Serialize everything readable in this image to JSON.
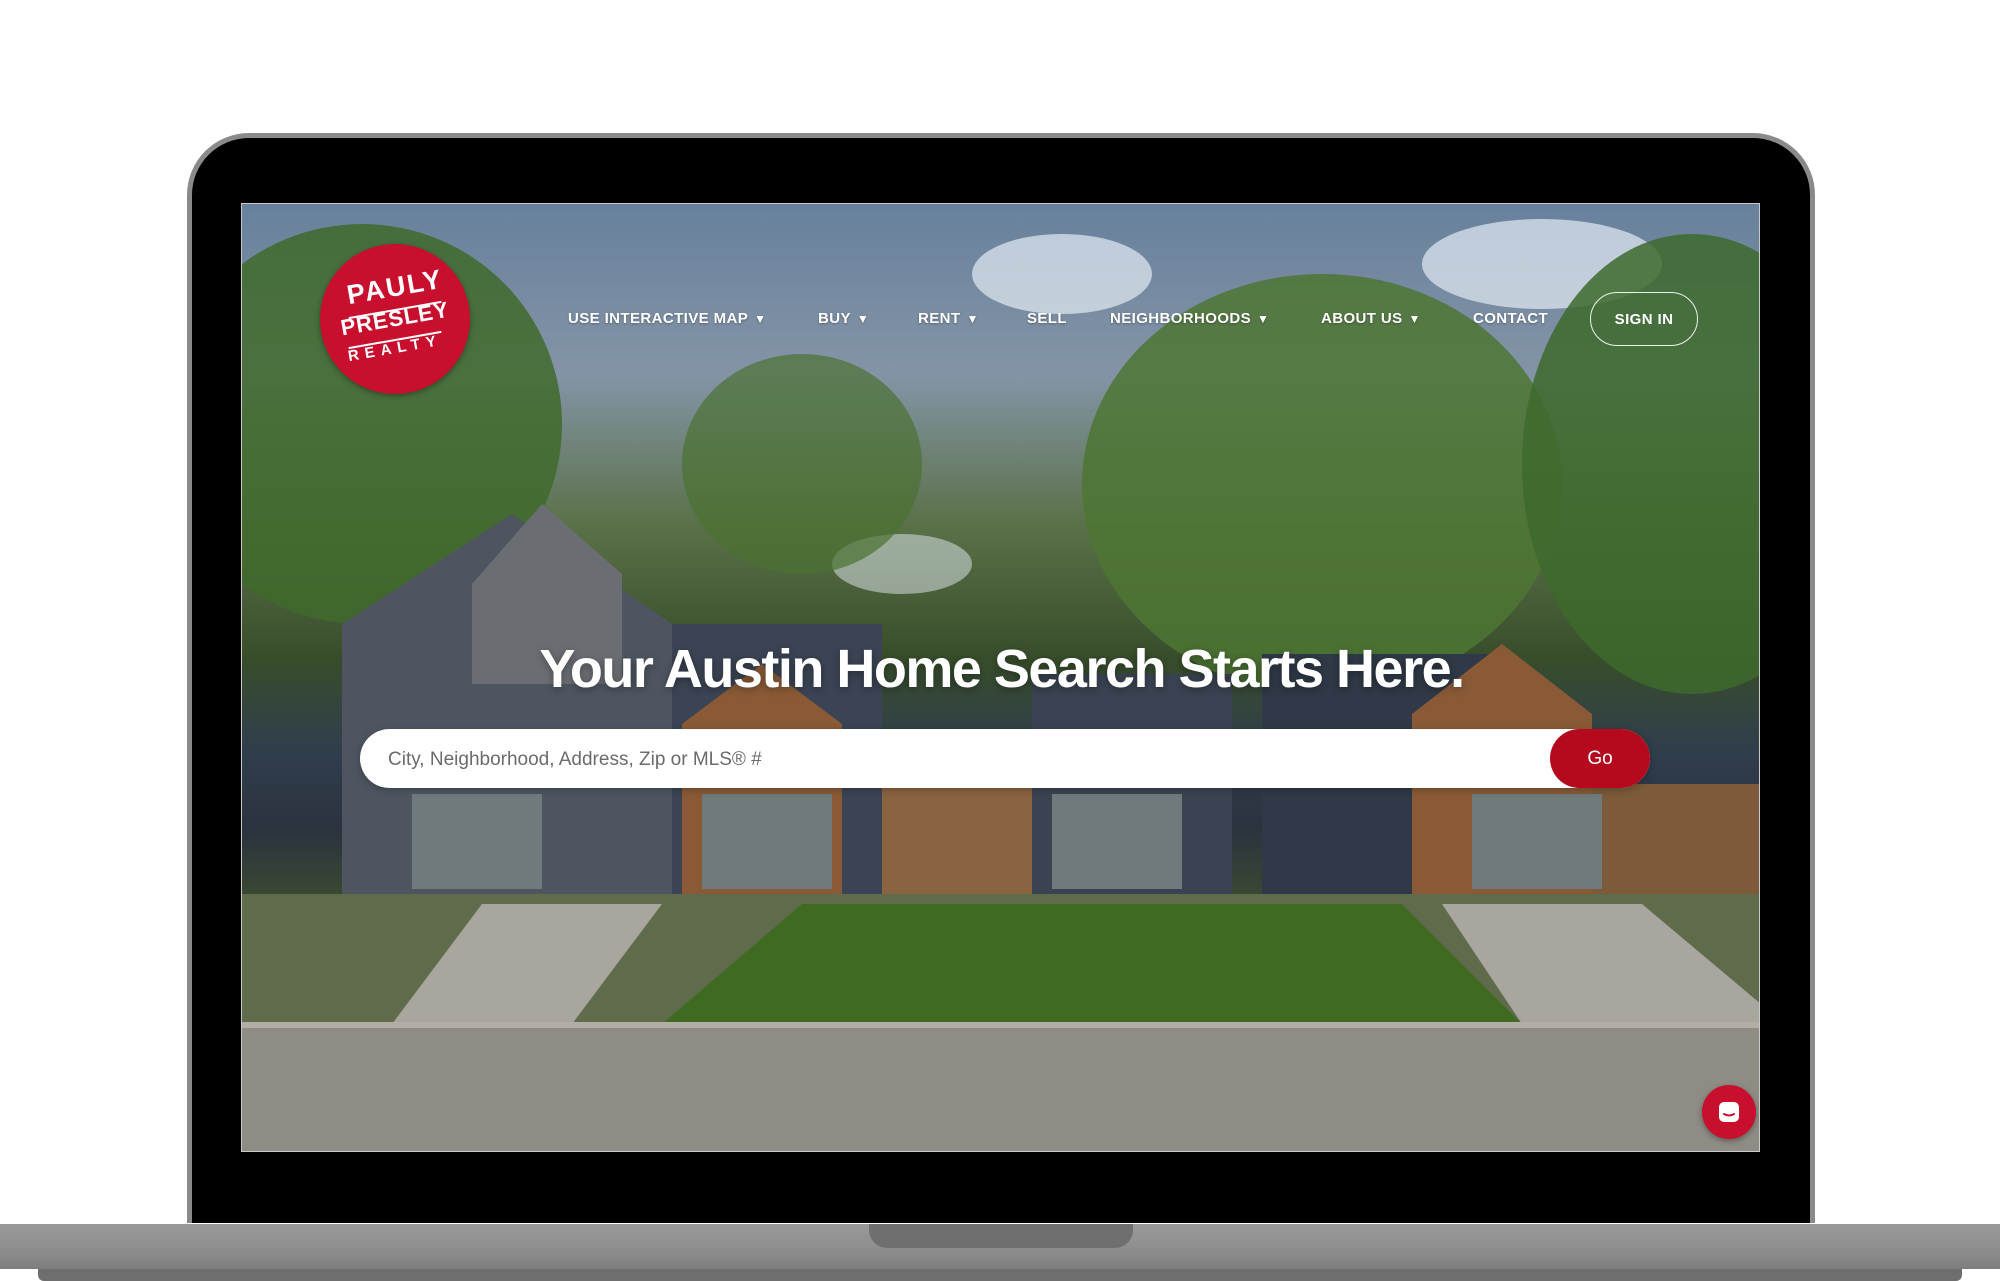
{
  "colors": {
    "brand_red": "#c8102e",
    "go_button": "#b5091e",
    "nav_text": "#ffffff"
  },
  "logo": {
    "line1": "PAULY",
    "line2": "PRESLEY",
    "line3": "REALTY"
  },
  "nav": {
    "items": [
      {
        "label": "USE INTERACTIVE MAP",
        "has_dropdown": true,
        "caret": "▼"
      },
      {
        "label": "BUY",
        "has_dropdown": true,
        "caret": "▼"
      },
      {
        "label": "RENT",
        "has_dropdown": true,
        "caret": "▼"
      },
      {
        "label": "SELL",
        "has_dropdown": false
      },
      {
        "label": "NEIGHBORHOODS",
        "has_dropdown": true,
        "caret": "▼"
      },
      {
        "label": "ABOUT US",
        "has_dropdown": true,
        "caret": "▼"
      },
      {
        "label": "CONTACT",
        "has_dropdown": false
      }
    ],
    "signin_label": "SIGN IN"
  },
  "hero": {
    "title": "Your Austin Home Search Starts Here."
  },
  "search": {
    "placeholder": "City, Neighborhood, Address, Zip or MLS® #",
    "button_label": "Go"
  },
  "chat": {
    "icon": "chat-icon"
  }
}
